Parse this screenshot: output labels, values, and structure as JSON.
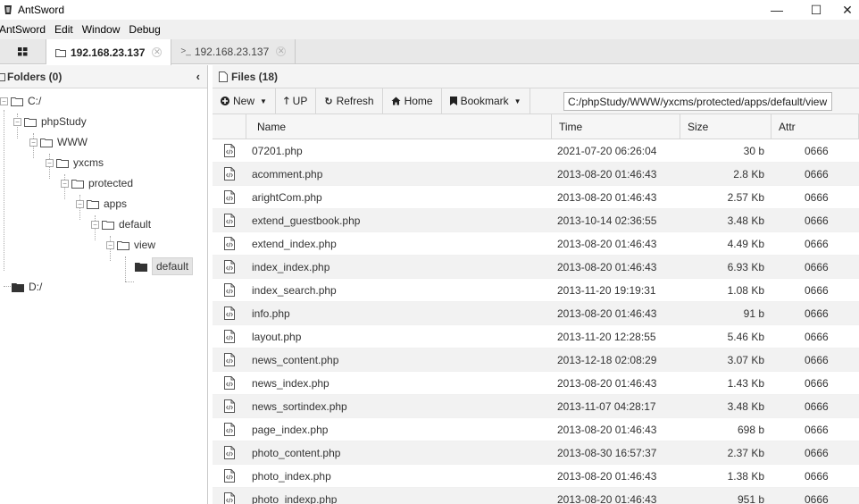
{
  "window": {
    "title": "AntSword",
    "controls": {
      "minimize": "—",
      "maximize": "☐",
      "close": "✕"
    }
  },
  "menu": [
    "AntSword",
    "Edit",
    "Window",
    "Debug"
  ],
  "tabs": [
    {
      "label": "192.168.23.137",
      "icon": "folder-icon",
      "active": true
    },
    {
      "label": "192.168.23.137",
      "icon": "terminal-icon",
      "active": false
    }
  ],
  "folders": {
    "header": "Folders (0)",
    "collapse_glyph": "‹",
    "tree": [
      {
        "label": "C:/",
        "expander": "−"
      },
      {
        "label": "phpStudy",
        "expander": "−"
      },
      {
        "label": "WWW",
        "expander": "−"
      },
      {
        "label": "yxcms",
        "expander": "−"
      },
      {
        "label": "protected",
        "expander": "−"
      },
      {
        "label": "apps",
        "expander": "−"
      },
      {
        "label": "default",
        "expander": "−"
      },
      {
        "label": "view",
        "expander": "−"
      },
      {
        "label": "default",
        "selected": true
      },
      {
        "label": "D:/"
      }
    ]
  },
  "files": {
    "header": "Files (18)",
    "toolbar": {
      "new_label": "New",
      "up_label": "UP",
      "refresh_label": "Refresh",
      "home_label": "Home",
      "bookmark_label": "Bookmark",
      "path_value": "C:/phpStudy/WWW/yxcms/protected/apps/default/view"
    },
    "columns": [
      "",
      "Name",
      "Time",
      "Size",
      "Attr"
    ],
    "rows": [
      {
        "name": "07201.php",
        "time": "2021-07-20 06:26:04",
        "size": "30 b",
        "attr": "0666"
      },
      {
        "name": "acomment.php",
        "time": "2013-08-20 01:46:43",
        "size": "2.8 Kb",
        "attr": "0666"
      },
      {
        "name": "arightCom.php",
        "time": "2013-08-20 01:46:43",
        "size": "2.57 Kb",
        "attr": "0666"
      },
      {
        "name": "extend_guestbook.php",
        "time": "2013-10-14 02:36:55",
        "size": "3.48 Kb",
        "attr": "0666"
      },
      {
        "name": "extend_index.php",
        "time": "2013-08-20 01:46:43",
        "size": "4.49 Kb",
        "attr": "0666"
      },
      {
        "name": "index_index.php",
        "time": "2013-08-20 01:46:43",
        "size": "6.93 Kb",
        "attr": "0666"
      },
      {
        "name": "index_search.php",
        "time": "2013-11-20 19:19:31",
        "size": "1.08 Kb",
        "attr": "0666"
      },
      {
        "name": "info.php",
        "time": "2013-08-20 01:46:43",
        "size": "91 b",
        "attr": "0666"
      },
      {
        "name": "layout.php",
        "time": "2013-11-20 12:28:55",
        "size": "5.46 Kb",
        "attr": "0666"
      },
      {
        "name": "news_content.php",
        "time": "2013-12-18 02:08:29",
        "size": "3.07 Kb",
        "attr": "0666"
      },
      {
        "name": "news_index.php",
        "time": "2013-08-20 01:46:43",
        "size": "1.43 Kb",
        "attr": "0666"
      },
      {
        "name": "news_sortindex.php",
        "time": "2013-11-07 04:28:17",
        "size": "3.48 Kb",
        "attr": "0666"
      },
      {
        "name": "page_index.php",
        "time": "2013-08-20 01:46:43",
        "size": "698 b",
        "attr": "0666"
      },
      {
        "name": "photo_content.php",
        "time": "2013-08-30 16:57:37",
        "size": "2.37 Kb",
        "attr": "0666"
      },
      {
        "name": "photo_index.php",
        "time": "2013-08-20 01:46:43",
        "size": "1.38 Kb",
        "attr": "0666"
      },
      {
        "name": "photo_indexp.php",
        "time": "2013-08-20 01:46:43",
        "size": "951 b",
        "attr": "0666"
      }
    ]
  }
}
